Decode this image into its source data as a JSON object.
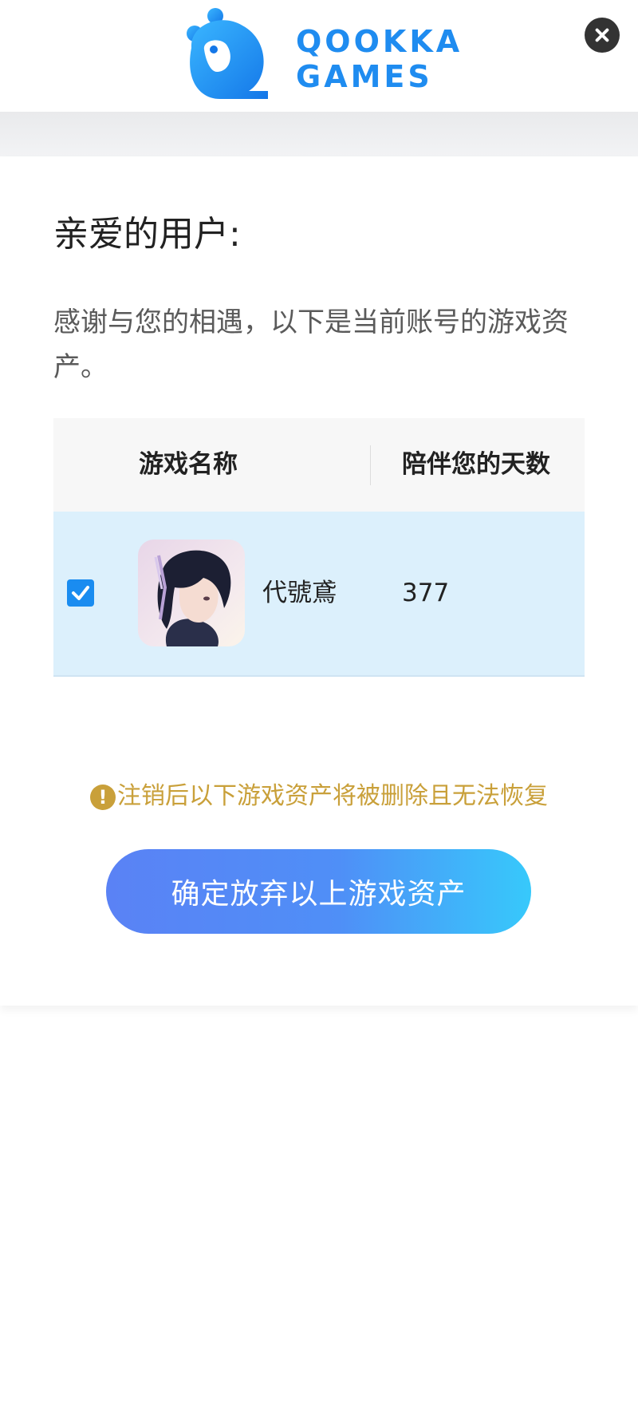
{
  "header": {
    "logo_text_line1": "QOOKKA",
    "logo_text_line2": "GAMES",
    "close_icon": "close-icon"
  },
  "content": {
    "greeting": "亲爱的用户:",
    "intro": "感谢与您的相遇，以下是当前账号的游戏资产。"
  },
  "table": {
    "headers": [
      "游戏名称",
      "陪伴您的天数"
    ],
    "rows": [
      {
        "checked": true,
        "icon": "game-character-icon",
        "name": "代號鳶",
        "days": "377"
      }
    ]
  },
  "warning": {
    "icon": "exclamation-icon",
    "text": "注销后以下游戏资产将被删除且无法恢复"
  },
  "button": {
    "confirm_label": "确定放弃以上游戏资产"
  },
  "colors": {
    "brand": "#1f8cf0",
    "row_highlight": "#dcf0fc",
    "warning": "#c9a03a",
    "button_gradient_start": "#5a82f5",
    "button_gradient_end": "#37c9fb"
  }
}
